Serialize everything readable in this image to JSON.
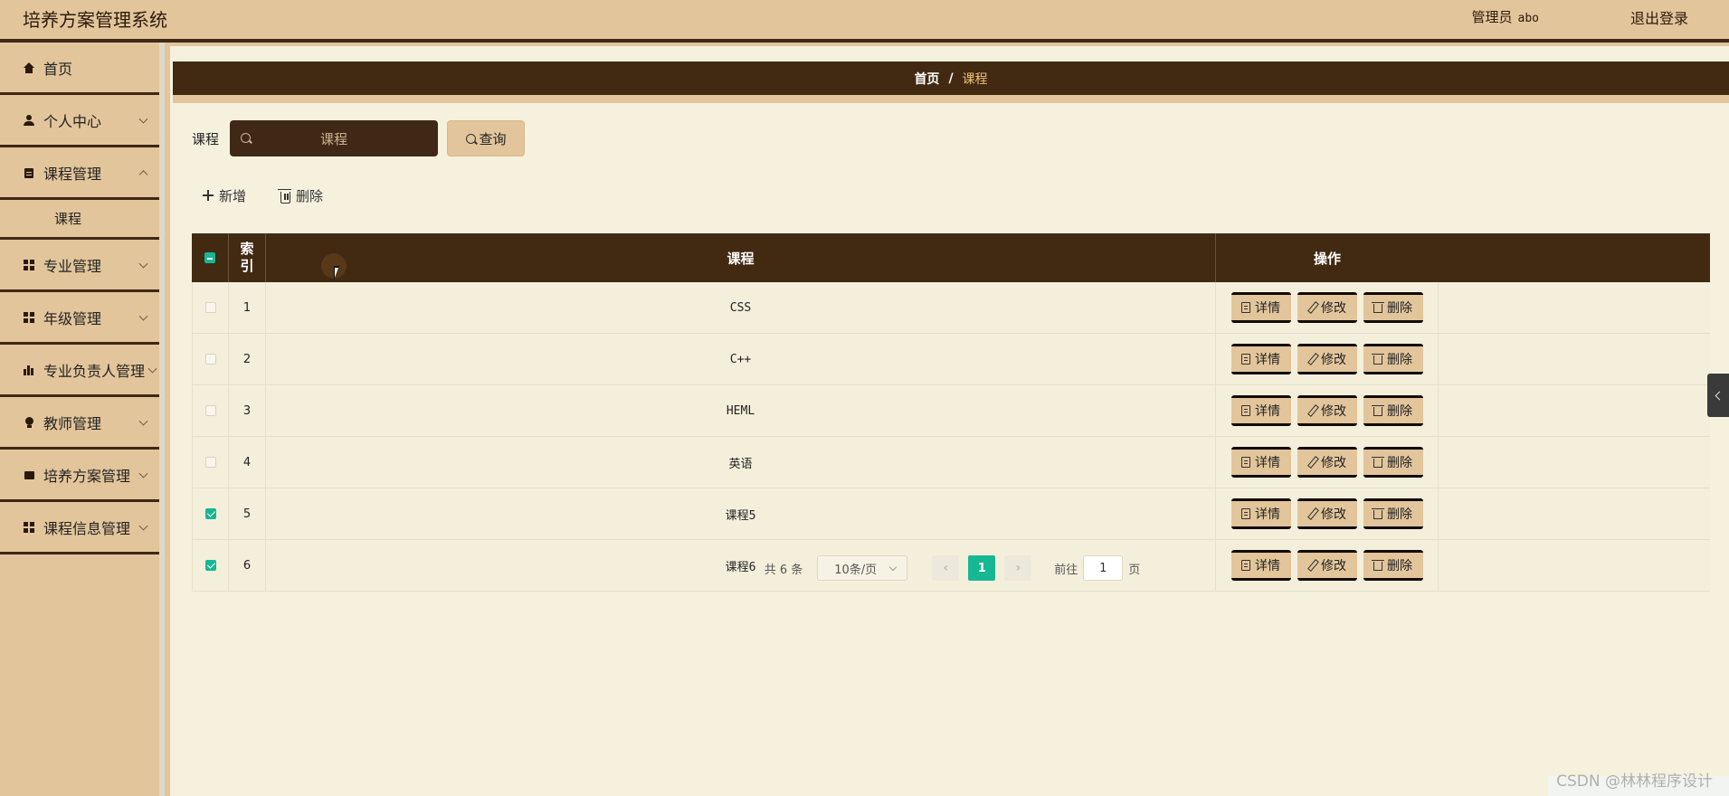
{
  "app": {
    "title": "培养方案管理系统",
    "user_role": "管理员",
    "username": "abo",
    "logout_label": "退出登录"
  },
  "sidebar": {
    "items": [
      {
        "label": "首页",
        "icon": "home-icon"
      },
      {
        "label": "个人中心",
        "icon": "user-icon"
      },
      {
        "label": "课程管理",
        "icon": "clipboard-icon"
      },
      {
        "label": "课程",
        "icon": ""
      },
      {
        "label": "专业管理",
        "icon": "grid-icon"
      },
      {
        "label": "年级管理",
        "icon": "grid-icon"
      },
      {
        "label": "专业负责人管理",
        "icon": "bar-chart-icon"
      },
      {
        "label": "教师管理",
        "icon": "bulb-icon"
      },
      {
        "label": "培养方案管理",
        "icon": "book-icon"
      },
      {
        "label": "课程信息管理",
        "icon": "grid-icon"
      }
    ]
  },
  "breadcrumb": {
    "home": "首页",
    "separator": "/",
    "current": "课程"
  },
  "search": {
    "label": "课程",
    "placeholder": "课程",
    "button_label": "查询"
  },
  "actions": {
    "add_label": "新增",
    "delete_label": "删除"
  },
  "table": {
    "headers": {
      "index": "索引",
      "course": "课程",
      "ops": "操作"
    },
    "rows": [
      {
        "index": "1",
        "course": "CSS",
        "checked": false
      },
      {
        "index": "2",
        "course": "C++",
        "checked": false
      },
      {
        "index": "3",
        "course": "HEML",
        "checked": false
      },
      {
        "index": "4",
        "course": "英语",
        "checked": false
      },
      {
        "index": "5",
        "course": "课程5",
        "checked": true
      },
      {
        "index": "6",
        "course": "课程6",
        "checked": true
      }
    ],
    "op_labels": {
      "detail": "详情",
      "edit": "修改",
      "delete": "删除"
    }
  },
  "pagination": {
    "total_text": "共 6 条",
    "page_size": "10条/页",
    "current_page": "1",
    "goto_prefix": "前往",
    "goto_value": "1",
    "goto_suffix": "页"
  },
  "watermark": "CSDN @林林程序设计",
  "colors": {
    "sidebar_bg": "#e2c59b",
    "dark_brown": "#412912",
    "content_bg": "#f5f1dd",
    "accent_green": "#17b794",
    "breadcrumb_current": "#f1c27a"
  }
}
